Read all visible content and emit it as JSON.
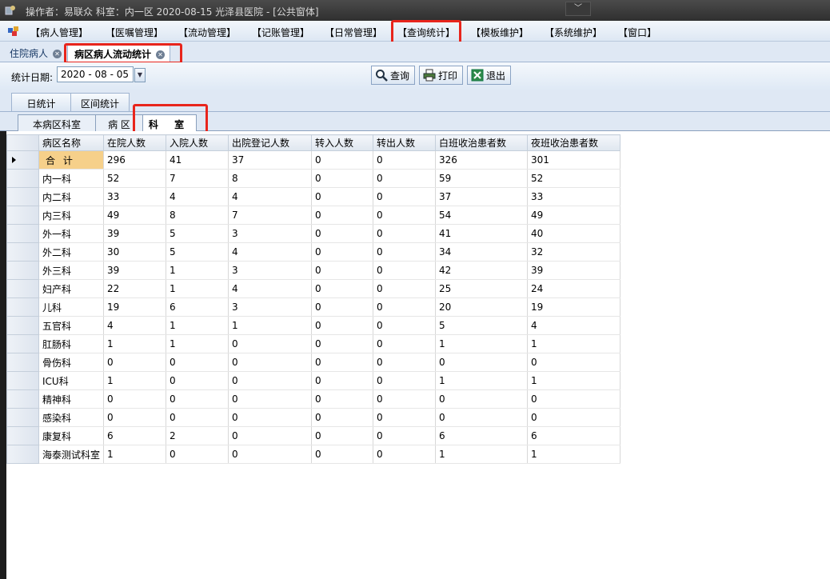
{
  "window": {
    "title": "操作者：易联众 科室：内一区 2020-08-15 光泽县医院 - [公共窗体]",
    "minimize_glyph": "﹀"
  },
  "menu": {
    "items": [
      "【病人管理】",
      "【医嘱管理】",
      "【流动管理】",
      "【记账管理】",
      "【日常管理】",
      "【查询统计】",
      "【模板维护】",
      "【系统维护】",
      "【窗口】"
    ]
  },
  "doc_tabs": [
    {
      "label": "住院病人"
    },
    {
      "label": "病区病人流动统计"
    }
  ],
  "toolbar": {
    "date_label": "统计日期:",
    "date_value": "2020 - 08 - 05",
    "query_label": "查询",
    "print_label": "打印",
    "exit_label": "退出"
  },
  "mode_tabs": [
    "日统计",
    "区间统计"
  ],
  "sub_tabs": [
    "本病区科室",
    "病 区",
    "科 室"
  ],
  "table": {
    "headers": [
      "病区名称",
      "在院人数",
      "入院人数",
      "出院登记人数",
      "转入人数",
      "转出人数",
      "白班收治患者数",
      "夜班收治患者数"
    ],
    "rows": [
      [
        "合 计",
        "296",
        "41",
        "37",
        "0",
        "0",
        "326",
        "301"
      ],
      [
        "内一科",
        "52",
        "7",
        "8",
        "0",
        "0",
        "59",
        "52"
      ],
      [
        "内二科",
        "33",
        "4",
        "4",
        "0",
        "0",
        "37",
        "33"
      ],
      [
        "内三科",
        "49",
        "8",
        "7",
        "0",
        "0",
        "54",
        "49"
      ],
      [
        "外一科",
        "39",
        "5",
        "3",
        "0",
        "0",
        "41",
        "40"
      ],
      [
        "外二科",
        "30",
        "5",
        "4",
        "0",
        "0",
        "34",
        "32"
      ],
      [
        "外三科",
        "39",
        "1",
        "3",
        "0",
        "0",
        "42",
        "39"
      ],
      [
        "妇产科",
        "22",
        "1",
        "4",
        "0",
        "0",
        "25",
        "24"
      ],
      [
        "儿科",
        "19",
        "6",
        "3",
        "0",
        "0",
        "20",
        "19"
      ],
      [
        "五官科",
        "4",
        "1",
        "1",
        "0",
        "0",
        "5",
        "4"
      ],
      [
        "肛肠科",
        "1",
        "1",
        "0",
        "0",
        "0",
        "1",
        "1"
      ],
      [
        "骨伤科",
        "0",
        "0",
        "0",
        "0",
        "0",
        "0",
        "0"
      ],
      [
        "ICU科",
        "1",
        "0",
        "0",
        "0",
        "0",
        "1",
        "1"
      ],
      [
        "精神科",
        "0",
        "0",
        "0",
        "0",
        "0",
        "0",
        "0"
      ],
      [
        "感染科",
        "0",
        "0",
        "0",
        "0",
        "0",
        "0",
        "0"
      ],
      [
        "康复科",
        "6",
        "2",
        "0",
        "0",
        "0",
        "6",
        "6"
      ],
      [
        "海泰测试科室",
        "1",
        "0",
        "0",
        "0",
        "0",
        "1",
        "1"
      ]
    ]
  },
  "colors": {
    "highlight_box": "#e8251c",
    "selected_cell": "#f6d08a"
  }
}
